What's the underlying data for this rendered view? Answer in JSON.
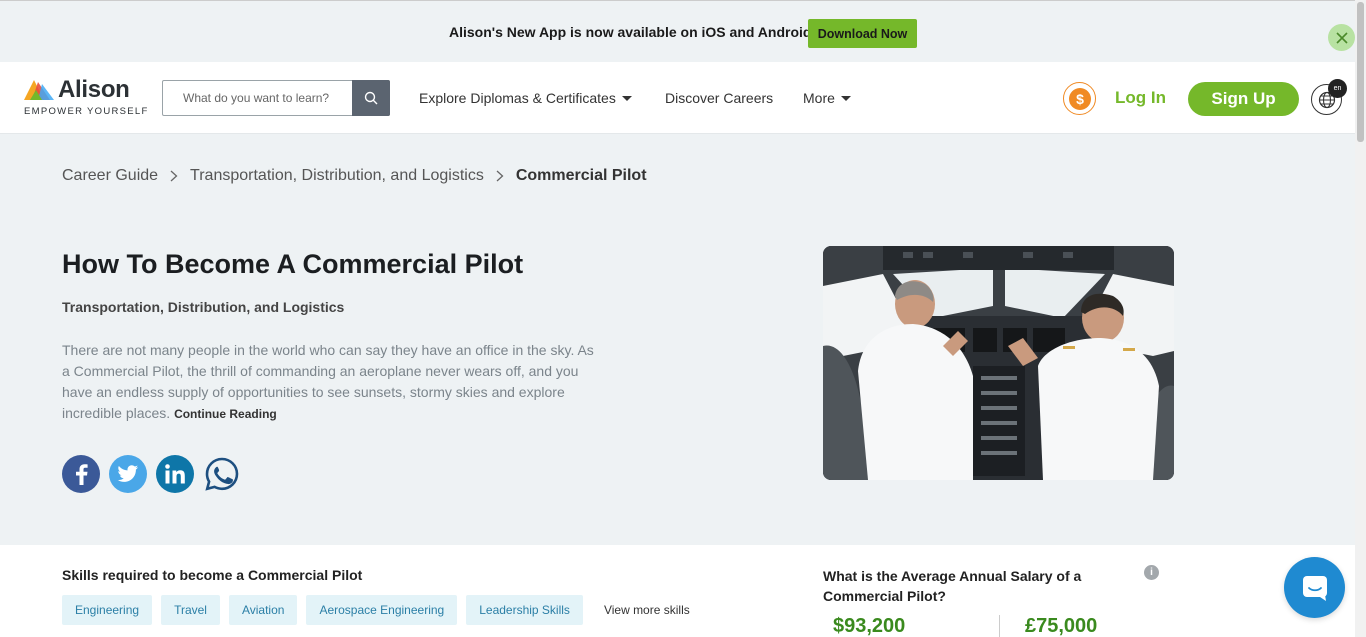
{
  "banner": {
    "message": "Alison's New App is now available on iOS and Android!",
    "download_label": "Download Now"
  },
  "header": {
    "logo_word": "Alison",
    "logo_tagline": "EMPOWER YOURSELF",
    "search_placeholder": "What do you want to learn?",
    "nav": {
      "explore": "Explore Diplomas & Certificates",
      "careers": "Discover Careers",
      "more": "More"
    },
    "login": "Log In",
    "signup": "Sign Up",
    "language": "en"
  },
  "breadcrumb": {
    "items": [
      "Career Guide",
      "Transportation, Distribution, and Logistics"
    ],
    "current": "Commercial Pilot"
  },
  "hero": {
    "title": "How To Become A Commercial Pilot",
    "category": "Transportation, Distribution, and Logistics",
    "description": "There are not many people in the world who can say they have an office in the sky. As a Commercial Pilot, the thrill of commanding an aeroplane never wears off, and you have an endless supply of opportunities to see sunsets, stormy skies and explore incredible places.",
    "continue_label": "Continue Reading"
  },
  "social": [
    "facebook-icon",
    "twitter-icon",
    "linkedin-icon",
    "whatsapp-icon"
  ],
  "skills": {
    "title": "Skills required to become a Commercial Pilot",
    "items": [
      "Engineering",
      "Travel",
      "Aviation",
      "Aerospace Engineering",
      "Leadership Skills"
    ],
    "more_label": "View more skills"
  },
  "salary": {
    "question": "What is the Average Annual Salary of a Commercial Pilot?",
    "usd": "$93,200",
    "gbp": "£75,000"
  },
  "colors": {
    "brand_green": "#75b82a",
    "dark_text": "#1b1e21",
    "chip_bg": "#e3f3f8",
    "chip_text": "#2b7fa6",
    "salary_green": "#3a8a1e",
    "coin_orange": "#f08a24",
    "chat_blue": "#1f8ad1"
  }
}
